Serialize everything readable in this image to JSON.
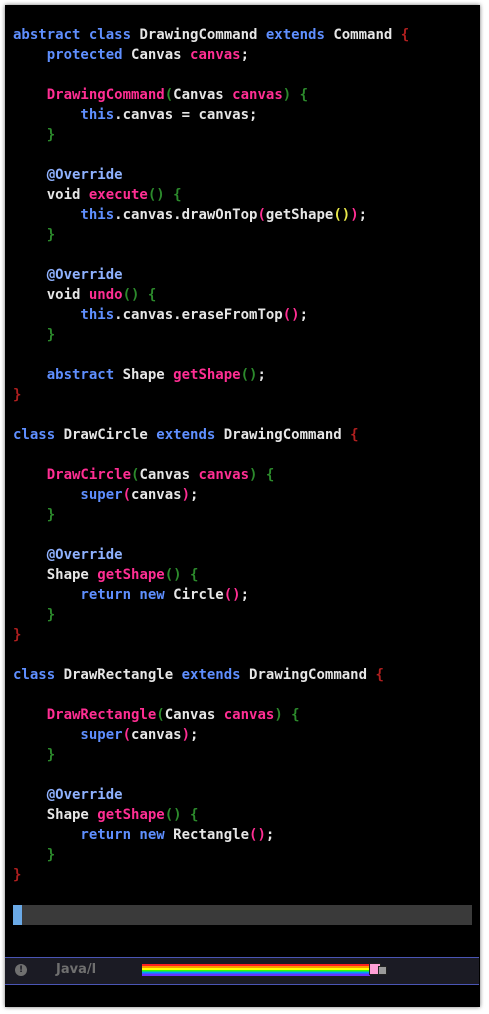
{
  "editor": {
    "lines": [
      [
        {
          "t": "abstract class ",
          "c": "kw"
        },
        {
          "t": "DrawingCommand ",
          "c": "ty"
        },
        {
          "t": "extends ",
          "c": "kw"
        },
        {
          "t": "Command ",
          "c": "ty"
        },
        {
          "t": "{",
          "c": "b1"
        }
      ],
      [
        {
          "t": "    protected ",
          "c": "kw"
        },
        {
          "t": "Canvas ",
          "c": "ty"
        },
        {
          "t": "canvas",
          "c": "fn"
        },
        {
          "t": ";",
          "c": "pl"
        }
      ],
      [],
      [
        {
          "t": "    DrawingCommand",
          "c": "fn"
        },
        {
          "t": "(",
          "c": "b2"
        },
        {
          "t": "Canvas ",
          "c": "ty"
        },
        {
          "t": "canvas",
          "c": "fn"
        },
        {
          "t": ") ",
          "c": "b2"
        },
        {
          "t": "{",
          "c": "b2"
        }
      ],
      [
        {
          "t": "        this",
          "c": "kw"
        },
        {
          "t": ".canvas = canvas;",
          "c": "pl"
        }
      ],
      [
        {
          "t": "    }",
          "c": "b2"
        }
      ],
      [],
      [
        {
          "t": "    @Override",
          "c": "ann"
        }
      ],
      [
        {
          "t": "    void ",
          "c": "ty"
        },
        {
          "t": "execute",
          "c": "fn"
        },
        {
          "t": "() {",
          "c": "b2"
        }
      ],
      [
        {
          "t": "        this",
          "c": "kw"
        },
        {
          "t": ".canvas.drawOnTop",
          "c": "pl"
        },
        {
          "t": "(",
          "c": "b4"
        },
        {
          "t": "getShape",
          "c": "pl"
        },
        {
          "t": "()",
          "c": "b3"
        },
        {
          "t": ")",
          "c": "b4"
        },
        {
          "t": ";",
          "c": "pl"
        }
      ],
      [
        {
          "t": "    }",
          "c": "b2"
        }
      ],
      [],
      [
        {
          "t": "    @Override",
          "c": "ann"
        }
      ],
      [
        {
          "t": "    void ",
          "c": "ty"
        },
        {
          "t": "undo",
          "c": "fn"
        },
        {
          "t": "() {",
          "c": "b2"
        }
      ],
      [
        {
          "t": "        this",
          "c": "kw"
        },
        {
          "t": ".canvas.eraseFromTop",
          "c": "pl"
        },
        {
          "t": "()",
          "c": "b4"
        },
        {
          "t": ";",
          "c": "pl"
        }
      ],
      [
        {
          "t": "    }",
          "c": "b2"
        }
      ],
      [],
      [
        {
          "t": "    abstract ",
          "c": "kw"
        },
        {
          "t": "Shape ",
          "c": "ty"
        },
        {
          "t": "getShape",
          "c": "fn"
        },
        {
          "t": "()",
          "c": "b2"
        },
        {
          "t": ";",
          "c": "pl"
        }
      ],
      [
        {
          "t": "}",
          "c": "b1"
        }
      ],
      [],
      [
        {
          "t": "class ",
          "c": "kw"
        },
        {
          "t": "DrawCircle ",
          "c": "ty"
        },
        {
          "t": "extends ",
          "c": "kw"
        },
        {
          "t": "DrawingCommand ",
          "c": "ty"
        },
        {
          "t": "{",
          "c": "b1"
        }
      ],
      [],
      [
        {
          "t": "    DrawCircle",
          "c": "fn"
        },
        {
          "t": "(",
          "c": "b2"
        },
        {
          "t": "Canvas ",
          "c": "ty"
        },
        {
          "t": "canvas",
          "c": "fn"
        },
        {
          "t": ") {",
          "c": "b2"
        }
      ],
      [
        {
          "t": "        super",
          "c": "kw"
        },
        {
          "t": "(",
          "c": "b4"
        },
        {
          "t": "canvas",
          "c": "pl"
        },
        {
          "t": ")",
          "c": "b4"
        },
        {
          "t": ";",
          "c": "pl"
        }
      ],
      [
        {
          "t": "    }",
          "c": "b2"
        }
      ],
      [],
      [
        {
          "t": "    @Override",
          "c": "ann"
        }
      ],
      [
        {
          "t": "    Shape ",
          "c": "ty"
        },
        {
          "t": "getShape",
          "c": "fn"
        },
        {
          "t": "() {",
          "c": "b2"
        }
      ],
      [
        {
          "t": "        return new ",
          "c": "kw"
        },
        {
          "t": "Circle",
          "c": "pl"
        },
        {
          "t": "()",
          "c": "b4"
        },
        {
          "t": ";",
          "c": "pl"
        }
      ],
      [
        {
          "t": "    }",
          "c": "b2"
        }
      ],
      [
        {
          "t": "}",
          "c": "b1"
        }
      ],
      [],
      [
        {
          "t": "class ",
          "c": "kw"
        },
        {
          "t": "DrawRectangle ",
          "c": "ty"
        },
        {
          "t": "extends ",
          "c": "kw"
        },
        {
          "t": "DrawingCommand ",
          "c": "ty"
        },
        {
          "t": "{",
          "c": "b1"
        }
      ],
      [],
      [
        {
          "t": "    DrawRectangle",
          "c": "fn"
        },
        {
          "t": "(",
          "c": "b2"
        },
        {
          "t": "Canvas ",
          "c": "ty"
        },
        {
          "t": "canvas",
          "c": "fn"
        },
        {
          "t": ") {",
          "c": "b2"
        }
      ],
      [
        {
          "t": "        super",
          "c": "kw"
        },
        {
          "t": "(",
          "c": "b4"
        },
        {
          "t": "canvas",
          "c": "pl"
        },
        {
          "t": ")",
          "c": "b4"
        },
        {
          "t": ";",
          "c": "pl"
        }
      ],
      [
        {
          "t": "    }",
          "c": "b2"
        }
      ],
      [],
      [
        {
          "t": "    @Override",
          "c": "ann"
        }
      ],
      [
        {
          "t": "    Shape ",
          "c": "ty"
        },
        {
          "t": "getShape",
          "c": "fn"
        },
        {
          "t": "() {",
          "c": "b2"
        }
      ],
      [
        {
          "t": "        return new ",
          "c": "kw"
        },
        {
          "t": "Rectangle",
          "c": "pl"
        },
        {
          "t": "()",
          "c": "b4"
        },
        {
          "t": ";",
          "c": "pl"
        }
      ],
      [
        {
          "t": "    }",
          "c": "b2"
        }
      ],
      [
        {
          "t": "}",
          "c": "b1"
        }
      ]
    ]
  },
  "modeline": {
    "info_icon": "info-icon",
    "info_glyph": "!",
    "mode": "Java/l",
    "progress_icon": "nyan-cat-icon"
  },
  "colors": {
    "background": "#000000",
    "keyword": "#5f8fff",
    "function": "#ff2e93",
    "annotation": "#8fb2ff",
    "text": "#e6e6e6",
    "bracket_depth_1": "#b01f1f",
    "bracket_depth_2": "#2c8a2c",
    "bracket_depth_3": "#e8e84a",
    "cursor": "#6aa9e6",
    "modeline_border": "#4a55b5"
  }
}
